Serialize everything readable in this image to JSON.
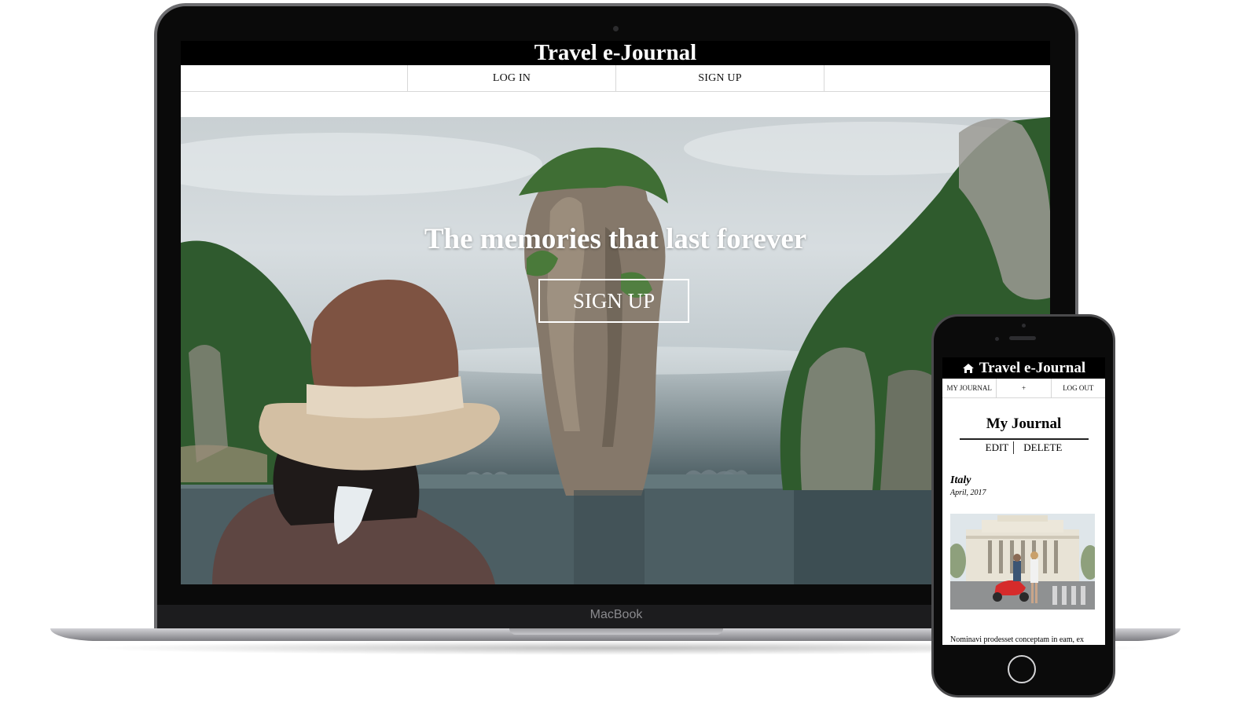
{
  "laptop": {
    "brand_label": "MacBook",
    "site": {
      "title": "Travel e-Journal",
      "nav": [
        "LOG IN",
        "SIGN UP"
      ],
      "hero": {
        "headline": "The memories that last forever",
        "cta_label": "SIGN UP"
      }
    }
  },
  "phone": {
    "site": {
      "title": "Travel e-Journal",
      "header_icon": "home-icon",
      "nav": [
        "MY JOURNAL",
        "+",
        "LOG OUT"
      ],
      "page_title": "My Journal",
      "actions": [
        "EDIT",
        "DELETE"
      ],
      "entry": {
        "title": "Italy",
        "date": "April, 2017",
        "body_preview": "Nominavi prodesset conceptam in eam, ex"
      }
    }
  },
  "colors": {
    "header_bg": "#000000",
    "header_text": "#ffffff",
    "nav_border": "#d8d8d8",
    "scooter": "#d62b2b"
  }
}
